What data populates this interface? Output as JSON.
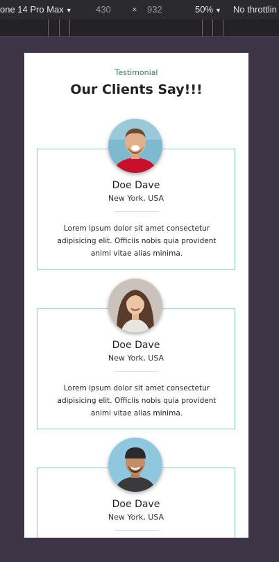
{
  "devtools": {
    "device_label": "one 14 Pro Max",
    "width": "430",
    "times": "×",
    "height": "932",
    "zoom": "50%",
    "throttle": "No throttlin"
  },
  "section": {
    "eyebrow": "Testimonial",
    "title": "Our Clients Say!!!"
  },
  "testimonials": [
    {
      "name": "Doe Dave",
      "location": "New York, USA",
      "quote": "Lorem ipsum dolor sit amet consectetur adipisicing elit. Officiis nobis quia provident animi vitae alias minima.",
      "avatar": "man-laughing-photo"
    },
    {
      "name": "Doe Dave",
      "location": "New York, USA",
      "quote": "Lorem ipsum dolor sit amet consectetur adipisicing elit. Officiis nobis quia provident animi vitae alias minima.",
      "avatar": "woman-smiling-photo"
    },
    {
      "name": "Doe Dave",
      "location": "New York, USA",
      "quote": "",
      "avatar": "man-cap-photo"
    }
  ],
  "colors": {
    "accent": "#2e7d57",
    "card_border": "#8fc9b3",
    "backdrop": "#3d3546"
  }
}
